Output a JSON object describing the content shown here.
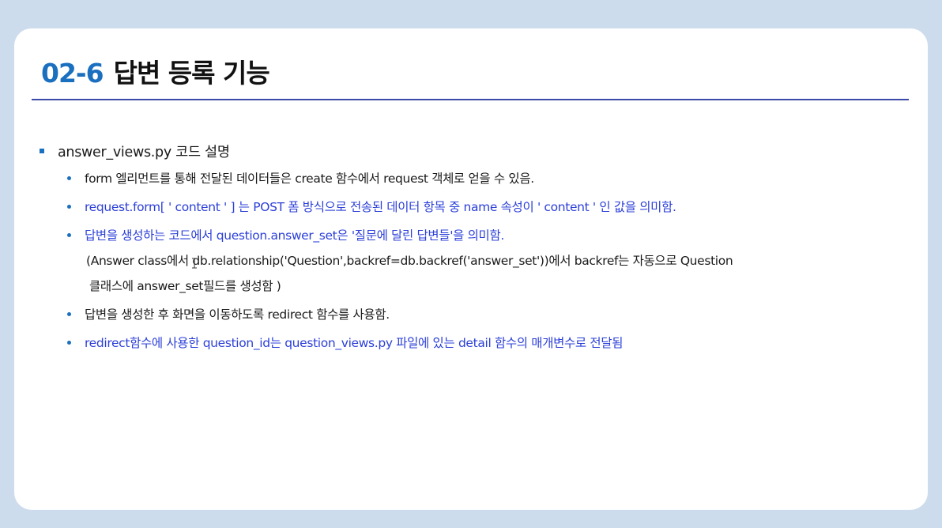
{
  "slide": {
    "title_number": "02-6",
    "title_text": "답변 등록 기능"
  },
  "section": {
    "heading": "answer_views.py 코드 설명",
    "items": [
      {
        "lines": [
          "form 엘리먼트를 통해 전달된 데이터들은 create 함수에서 request 객체로 얻을 수 있음."
        ],
        "color": "#1a1a1a"
      },
      {
        "lines": [
          "request.form[ ' content ' ] 는 POST 폼 방식으로 전송된 데이터 항목 중 name 속성이  ' content ' 인 값을 의미함."
        ],
        "color": "#2b3fd8"
      },
      {
        "lines": [
          "답변을 생성하는 코드에서 question.answer_set은 '질문에 달린 답변들'을 의미함.",
          "(Answer class에서 db.relationship('Question',backref=db.backref('answer_set'))에서 backref는 자동으로 Question",
          "클래스에 answer_set필드를 생성함 )"
        ],
        "color": "#2b3fd8"
      },
      {
        "lines": [
          "답변을 생성한 후 화면을 이동하도록 redirect 함수를 사용함."
        ],
        "color": "#1a1a1a"
      },
      {
        "lines": [
          "redirect함수에 사용한 question_id는 question_views.py 파일에 있는 detail 함수의 매개변수로 전달됨"
        ],
        "color": "#2b3fd8"
      }
    ]
  },
  "colors": {
    "accent": "#1a6fbf",
    "rule": "#3b4aa8",
    "highlight_text": "#2b3fd8",
    "background": "#cddcec"
  },
  "icons": {
    "cursor": "text-cursor-icon"
  }
}
